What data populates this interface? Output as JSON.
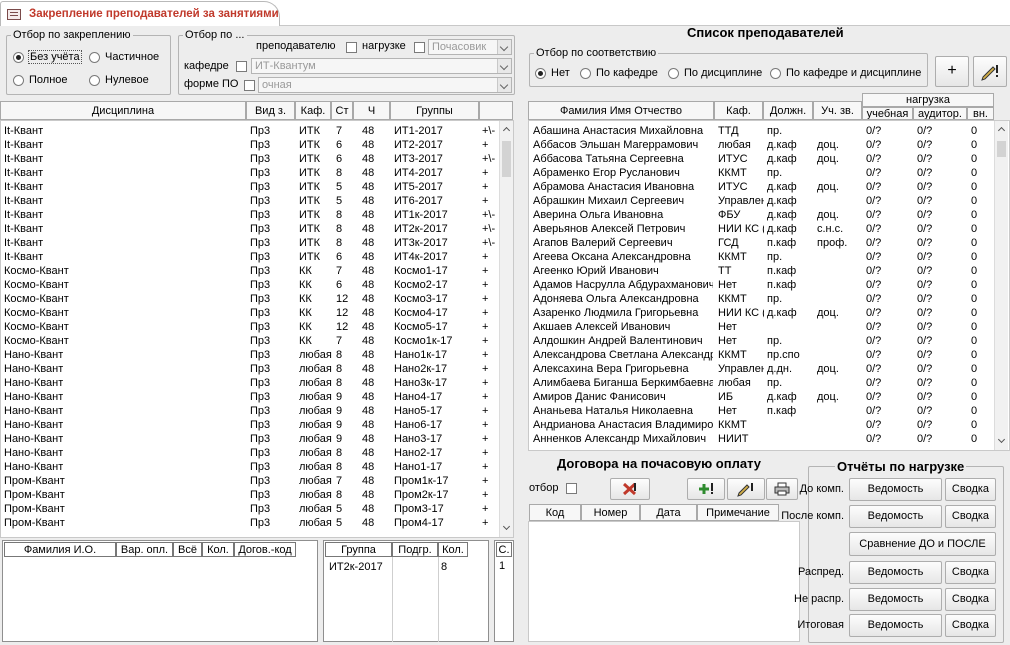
{
  "tab": {
    "title": "Закрепление преподавателей за занятиями",
    "icon": "form-icon"
  },
  "filter_assign": {
    "legend": "Отбор по закреплению",
    "options": [
      "Без учёта",
      "Частичное",
      "Полное",
      "Нулевое"
    ],
    "selected": "Без учёта"
  },
  "filter_by": {
    "legend": "Отбор по ...",
    "teacher_label": "преподавателю",
    "load_label": "нагрузке",
    "load_value": "Почасовик",
    "dept_label": "кафедре",
    "dept_value": "ИТ-Квантум",
    "form_label": "форме ПО",
    "form_value": "очная"
  },
  "disciplines": {
    "headers": [
      "Дисциплина",
      "Вид з.",
      "Каф.",
      "Ст",
      "Ч",
      "Группы"
    ],
    "rows": [
      [
        "It-Квант",
        "Пр3",
        "ИТК",
        "7",
        "48",
        "ИТ1-2017",
        "+\\-"
      ],
      [
        "It-Квант",
        "Пр3",
        "ИТК",
        "6",
        "48",
        "ИТ2-2017",
        "+"
      ],
      [
        "It-Квант",
        "Пр3",
        "ИТК",
        "6",
        "48",
        "ИТ3-2017",
        "+\\-"
      ],
      [
        "It-Квант",
        "Пр3",
        "ИТК",
        "8",
        "48",
        "ИТ4-2017",
        "+"
      ],
      [
        "It-Квант",
        "Пр3",
        "ИТК",
        "5",
        "48",
        "ИТ5-2017",
        "+"
      ],
      [
        "It-Квант",
        "Пр3",
        "ИТК",
        "5",
        "48",
        "ИТ6-2017",
        "+"
      ],
      [
        "It-Квант",
        "Пр3",
        "ИТК",
        "8",
        "48",
        "ИТ1к-2017",
        "+\\-"
      ],
      [
        "It-Квант",
        "Пр3",
        "ИТК",
        "8",
        "48",
        "ИТ2к-2017",
        "+\\-"
      ],
      [
        "It-Квант",
        "Пр3",
        "ИТК",
        "8",
        "48",
        "ИТ3к-2017",
        "+\\-"
      ],
      [
        "It-Квант",
        "Пр3",
        "ИТК",
        "6",
        "48",
        "ИТ4к-2017",
        "+"
      ],
      [
        "Космо-Квант",
        "Пр3",
        "КК",
        "7",
        "48",
        "Космо1-17",
        "+"
      ],
      [
        "Космо-Квант",
        "Пр3",
        "КК",
        "6",
        "48",
        "Космо2-17",
        "+"
      ],
      [
        "Космо-Квант",
        "Пр3",
        "КК",
        "12",
        "48",
        "Космо3-17",
        "+"
      ],
      [
        "Космо-Квант",
        "Пр3",
        "КК",
        "12",
        "48",
        "Космо4-17",
        "+"
      ],
      [
        "Космо-Квант",
        "Пр3",
        "КК",
        "12",
        "48",
        "Космо5-17",
        "+"
      ],
      [
        "Космо-Квант",
        "Пр3",
        "КК",
        "7",
        "48",
        "Космо1к-17",
        "+"
      ],
      [
        "Нано-Квант",
        "Пр3",
        "любая",
        "8",
        "48",
        "Нано1к-17",
        "+"
      ],
      [
        "Нано-Квант",
        "Пр3",
        "любая",
        "8",
        "48",
        "Нано2к-17",
        "+"
      ],
      [
        "Нано-Квант",
        "Пр3",
        "любая",
        "8",
        "48",
        "Нано3к-17",
        "+"
      ],
      [
        "Нано-Квант",
        "Пр3",
        "любая",
        "9",
        "48",
        "Нано4-17",
        "+"
      ],
      [
        "Нано-Квант",
        "Пр3",
        "любая",
        "9",
        "48",
        "Нано5-17",
        "+"
      ],
      [
        "Нано-Квант",
        "Пр3",
        "любая",
        "9",
        "48",
        "Нано6-17",
        "+"
      ],
      [
        "Нано-Квант",
        "Пр3",
        "любая",
        "9",
        "48",
        "Нано3-17",
        "+"
      ],
      [
        "Нано-Квант",
        "Пр3",
        "любая",
        "8",
        "48",
        "Нано2-17",
        "+"
      ],
      [
        "Нано-Квант",
        "Пр3",
        "любая",
        "8",
        "48",
        "Нано1-17",
        "+"
      ],
      [
        "Пром-Квант",
        "Пр3",
        "любая",
        "7",
        "48",
        "Пром1к-17",
        "+"
      ],
      [
        "Пром-Квант",
        "Пр3",
        "любая",
        "8",
        "48",
        "Пром2к-17",
        "+"
      ],
      [
        "Пром-Квант",
        "Пр3",
        "любая",
        "5",
        "48",
        "Пром3-17",
        "+"
      ],
      [
        "Пром-Квант",
        "Пр3",
        "любая",
        "5",
        "48",
        "Пром4-17",
        "+"
      ]
    ]
  },
  "assign": {
    "headers": [
      "Фамилия И.О.",
      "Вар. опл.",
      "Всё",
      "Кол.",
      "Догов.-код"
    ]
  },
  "groups": {
    "headers": [
      "Группа",
      "Подгр.",
      "Кол."
    ],
    "rows": [
      [
        "ИТ2к-2017",
        "",
        "8"
      ]
    ],
    "side_header": "С.",
    "side_value": "1"
  },
  "teachers": {
    "title": "Список преподавателей",
    "filter_legend": "Отбор по соответствию",
    "filter_options": [
      "Нет",
      "По кафедре",
      "По дисциплине",
      "По кафедре и дисциплине"
    ],
    "filter_selected": "Нет",
    "add_label": "+",
    "headers": [
      "Фамилия Имя Отчество",
      "Каф.",
      "Должн.",
      "Уч. зв."
    ],
    "load_header": "нагрузка",
    "load_sub": [
      "учебная",
      "аудитор.",
      "вн."
    ],
    "rows": [
      [
        "Абашина Анастасия Михайловна",
        "ТТД",
        "пр.",
        "",
        "0/?",
        "0/?",
        "0"
      ],
      [
        "Аббасов Эльшан Магеррамович",
        "любая",
        "д.каф",
        "доц.",
        "0/?",
        "0/?",
        "0"
      ],
      [
        "Аббасова Татьяна Сергеевна",
        "ИТУС",
        "д.каф",
        "доц.",
        "0/?",
        "0/?",
        "0"
      ],
      [
        "Абраменко Егор Русланович",
        "ККМТ",
        "пр.",
        "",
        "0/?",
        "0/?",
        "0"
      ],
      [
        "Абрамова Анастасия Ивановна",
        "ИТУС",
        "д.каф",
        "доц.",
        "0/?",
        "0/?",
        "0"
      ],
      [
        "Абрашкин Михаил Сергеевич",
        "Управлен",
        "д.каф",
        "",
        "0/?",
        "0/?",
        "0"
      ],
      [
        "Аверина Ольга Ивановна",
        "ФБУ",
        "д.каф",
        "доц.",
        "0/?",
        "0/?",
        "0"
      ],
      [
        "Аверьянов Алексей Петрович",
        "НИИ КС (",
        "д.каф",
        "с.н.с.",
        "0/?",
        "0/?",
        "0"
      ],
      [
        "Агапов Валерий Сергеевич",
        "ГСД",
        "п.каф",
        "проф.",
        "0/?",
        "0/?",
        "0"
      ],
      [
        "Агеева Оксана Александровна",
        "ККМТ",
        "пр.",
        "",
        "0/?",
        "0/?",
        "0"
      ],
      [
        "Агеенко Юрий Иванович",
        "ТТ",
        "п.каф",
        "",
        "0/?",
        "0/?",
        "0"
      ],
      [
        "Адамов Насрулла Абдурахманович",
        "Нет",
        "п.каф",
        "",
        "0/?",
        "0/?",
        "0"
      ],
      [
        "Адоняева Ольга Александровна",
        "ККМТ",
        "пр.",
        "",
        "0/?",
        "0/?",
        "0"
      ],
      [
        "Азаренко Людмила Григорьевна",
        "НИИ КС (",
        "д.каф",
        "доц.",
        "0/?",
        "0/?",
        "0"
      ],
      [
        "Акшаев Алексей Иванович",
        "Нет",
        "",
        "",
        "0/?",
        "0/?",
        "0"
      ],
      [
        "Алдошкин Андрей Валентинович",
        "Нет",
        "пр.",
        "",
        "0/?",
        "0/?",
        "0"
      ],
      [
        "Александрова Светлана Александр",
        "ККМТ",
        "пр.спо",
        "",
        "0/?",
        "0/?",
        "0"
      ],
      [
        "Алексахина Вера Григорьевна",
        "Управлен",
        "д.дн.",
        "доц.",
        "0/?",
        "0/?",
        "0"
      ],
      [
        "Алимбаева Биганша Беркимбаевна",
        "любая",
        "пр.",
        "",
        "0/?",
        "0/?",
        "0"
      ],
      [
        "Амиров Данис Фанисович",
        "ИБ",
        "д.каф",
        "доц.",
        "0/?",
        "0/?",
        "0"
      ],
      [
        "Ананьева Наталья Николаевна",
        "Нет",
        "п.каф",
        "",
        "0/?",
        "0/?",
        "0"
      ],
      [
        "Андрианова Анастасия Владимиров",
        "ККМТ",
        "",
        "",
        "0/?",
        "0/?",
        "0"
      ],
      [
        "Анненков Александр Михайлович",
        "НИИТ",
        "",
        "",
        "0/?",
        "0/?",
        "0"
      ]
    ]
  },
  "contracts": {
    "title": "Договора на почасовую оплату",
    "filter_label": "отбор",
    "headers": [
      "Код",
      "Номер",
      "Дата",
      "Примечание"
    ]
  },
  "reports": {
    "legend": "Отчёты по нагрузке",
    "rows": [
      {
        "label": "До комп.",
        "a": "Ведомость",
        "b": "Сводка"
      },
      {
        "label": "После комп.",
        "a": "Ведомость",
        "b": "Сводка"
      },
      {
        "label": "Распред.",
        "a": "Ведомость",
        "b": "Сводка"
      },
      {
        "label": "Не распр.",
        "a": "Ведомость",
        "b": "Сводка"
      },
      {
        "label": "Итоговая",
        "a": "Ведомость",
        "b": "Сводка"
      }
    ],
    "compare_label": "Сравнение ДО и ПОСЛЕ"
  }
}
